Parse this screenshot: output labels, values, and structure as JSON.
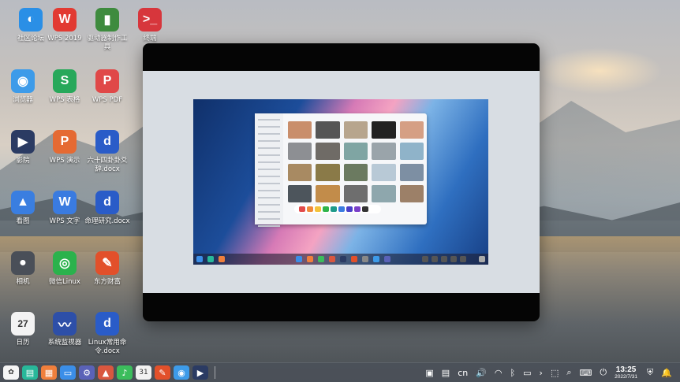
{
  "desktop_icons": [
    {
      "label": "社区论坛",
      "glyph": "◐",
      "bg": "#2a8fe6",
      "icon": "forum-icon"
    },
    {
      "label": "WPS 2019",
      "glyph": "W",
      "bg": "#e23a32",
      "icon": "wps-office-icon"
    },
    {
      "label": "驱动器制作工具",
      "glyph": "▮",
      "bg": "#3e8b3e",
      "icon": "usb-drive-icon"
    },
    {
      "label": "终端",
      "glyph": ">_",
      "bg": "#d7363c",
      "icon": "terminal-icon"
    },
    {
      "label": "浏览器",
      "glyph": "◉",
      "bg": "#3d9be9",
      "icon": "browser-icon"
    },
    {
      "label": "WPS 表格",
      "glyph": "S",
      "bg": "#27a85a",
      "icon": "wps-spreadsheet-icon"
    },
    {
      "label": "WPS PDF",
      "glyph": "P",
      "bg": "#e04848",
      "icon": "wps-pdf-icon"
    },
    {
      "label": "影院",
      "glyph": "▶",
      "bg": "#2b3b63",
      "icon": "movie-player-icon"
    },
    {
      "label": "WPS 演示",
      "glyph": "P",
      "bg": "#e56a33",
      "icon": "wps-presentation-icon"
    },
    {
      "label": "六十四卦卦爻辞.docx",
      "glyph": "d",
      "bg": "#2a5cc8",
      "icon": "docx-file-icon"
    },
    {
      "label": "看图",
      "glyph": "▲",
      "bg": "#3a7ee0",
      "icon": "image-viewer-icon"
    },
    {
      "label": "WPS 文字",
      "glyph": "W",
      "bg": "#3a7be0",
      "icon": "wps-writer-icon"
    },
    {
      "label": "命理研究.docx",
      "glyph": "d",
      "bg": "#2a5cc8",
      "icon": "docx-file-icon"
    },
    {
      "label": "相机",
      "glyph": "●",
      "bg": "#4a4f58",
      "icon": "camera-icon"
    },
    {
      "label": "微信Linux",
      "glyph": "◎",
      "bg": "#2bb24c",
      "icon": "wechat-icon"
    },
    {
      "label": "东方财富",
      "glyph": "✎",
      "bg": "#e2502a",
      "icon": "eastmoney-icon"
    },
    {
      "label": "日历",
      "glyph": "27",
      "bg": "#f3f3f3",
      "icon": "calendar-icon"
    },
    {
      "label": "系统监视器",
      "glyph": "〰",
      "bg": "#2d4fa8",
      "icon": "system-monitor-icon"
    },
    {
      "label": "Linux常用命令.docx",
      "glyph": "d",
      "bg": "#2a5cc8",
      "icon": "docx-file-icon"
    }
  ],
  "taskbar": {
    "apps": [
      {
        "icon": "launcher-icon",
        "glyph": "✿",
        "bg": "#f5f5f5"
      },
      {
        "icon": "multitask-view-icon",
        "glyph": "▤",
        "bg": "#28b89a"
      },
      {
        "icon": "app-store-icon",
        "glyph": "▦",
        "bg": "#f07f3c"
      },
      {
        "icon": "file-manager-icon",
        "glyph": "▭",
        "bg": "#3b8ee8"
      },
      {
        "icon": "settings-icon",
        "glyph": "⚙",
        "bg": "#5a62b8"
      },
      {
        "icon": "image-viewer-icon",
        "glyph": "▲",
        "bg": "#d9573f"
      },
      {
        "icon": "music-icon",
        "glyph": "♪",
        "bg": "#3bbd5c"
      },
      {
        "icon": "calendar-icon",
        "glyph": "31",
        "bg": "#f2f2f2"
      },
      {
        "icon": "eastmoney-icon",
        "glyph": "✎",
        "bg": "#e2502a"
      },
      {
        "icon": "browser-icon",
        "glyph": "◉",
        "bg": "#3d9be9"
      },
      {
        "icon": "movie-player-icon",
        "glyph": "▶",
        "bg": "#2b3b63"
      }
    ],
    "tray": {
      "input_method": "cn",
      "time": "13:25",
      "date": "2022/7/31"
    }
  }
}
